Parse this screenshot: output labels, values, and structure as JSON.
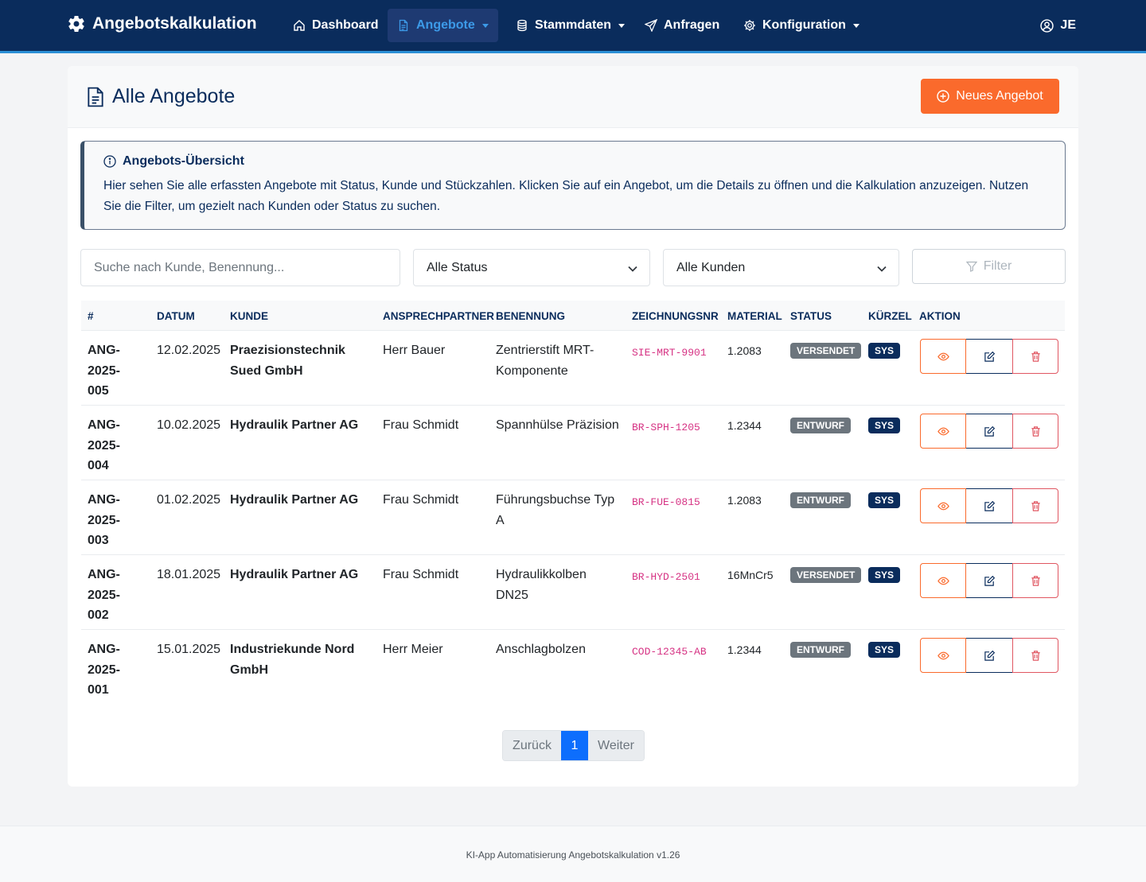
{
  "navbar": {
    "brand": "Angebotskalkulation",
    "items": [
      {
        "label": "Dashboard"
      },
      {
        "label": "Angebote"
      },
      {
        "label": "Stammdaten"
      },
      {
        "label": "Anfragen"
      },
      {
        "label": "Konfiguration"
      }
    ],
    "user": "JE",
    "colors": {
      "background": "#0a2c5c",
      "active_text": "#3c9ae8",
      "accent_line": "#2b8fd6"
    }
  },
  "page": {
    "title": "Alle Angebote",
    "new_button": "Neues Angebot",
    "accent": "#fa6a2c"
  },
  "info": {
    "title": "Angebots-Übersicht",
    "text": "Hier sehen Sie alle erfassten Angebote mit Status, Kunde und Stückzahlen. Klicken Sie auf ein Angebot, um die Details zu öffnen und die Kalkulation anzuzeigen. Nutzen Sie die Filter, um gezielt nach Kunden oder Status zu suchen."
  },
  "filters": {
    "search_placeholder": "Suche nach Kunde, Benennung...",
    "status_selected": "Alle Status",
    "customer_selected": "Alle Kunden",
    "filter_button": "Filter"
  },
  "table": {
    "headers": [
      "#",
      "DATUM",
      "KUNDE",
      "ANSPRECHPARTNER",
      "BENENNUNG",
      "ZEICHNUNGSNR",
      "MATERIAL",
      "STATUS",
      "KÜRZEL",
      "AKTION"
    ],
    "rows": [
      {
        "id": "ANG-2025-005",
        "datum": "12.02.2025",
        "kunde": "Praezisionstechnik Sued GmbH",
        "ansprechpartner": "Herr Bauer",
        "benennung": "Zentrierstift MRT-Komponente",
        "zeichnungsnr": "SIE-MRT-9901",
        "material": "1.2083",
        "status": "VERSENDET",
        "kuerzel": "SYS"
      },
      {
        "id": "ANG-2025-004",
        "datum": "10.02.2025",
        "kunde": "Hydraulik Partner AG",
        "ansprechpartner": "Frau Schmidt",
        "benennung": "Spannhülse Präzision",
        "zeichnungsnr": "BR-SPH-1205",
        "material": "1.2344",
        "status": "ENTWURF",
        "kuerzel": "SYS"
      },
      {
        "id": "ANG-2025-003",
        "datum": "01.02.2025",
        "kunde": "Hydraulik Partner AG",
        "ansprechpartner": "Frau Schmidt",
        "benennung": "Führungsbuchse Typ A",
        "zeichnungsnr": "BR-FUE-0815",
        "material": "1.2083",
        "status": "ENTWURF",
        "kuerzel": "SYS"
      },
      {
        "id": "ANG-2025-002",
        "datum": "18.01.2025",
        "kunde": "Hydraulik Partner AG",
        "ansprechpartner": "Frau Schmidt",
        "benennung": "Hydraulikkolben DN25",
        "zeichnungsnr": "BR-HYD-2501",
        "material": "16MnCr5",
        "status": "VERSENDET",
        "kuerzel": "SYS"
      },
      {
        "id": "ANG-2025-001",
        "datum": "15.01.2025",
        "kunde": "Industriekunde Nord GmbH",
        "ansprechpartner": "Herr Meier",
        "benennung": "Anschlagbolzen",
        "zeichnungsnr": "COD-12345-AB",
        "material": "1.2344",
        "status": "ENTWURF",
        "kuerzel": "SYS"
      }
    ],
    "action_icons": [
      "eye-icon",
      "edit-icon",
      "trash-icon"
    ]
  },
  "pagination": {
    "prev": "Zurück",
    "current": "1",
    "next": "Weiter"
  },
  "footer": {
    "text": "KI-App Automatisierung Angebotskalkulation v1.26"
  }
}
